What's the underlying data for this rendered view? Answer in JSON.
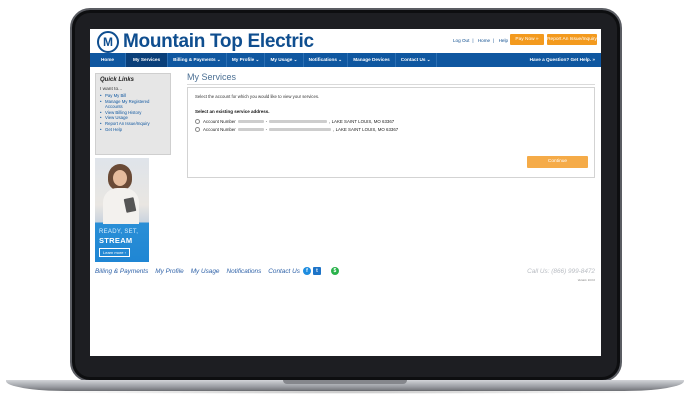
{
  "header": {
    "brand": "Mountain Top Electric",
    "logo_glyph": "M",
    "top_links": [
      "Log Out",
      "Home",
      "Help"
    ],
    "pay_now": "Pay Now »",
    "report_issue": "Report An Issue/Inquiry"
  },
  "nav": {
    "items": [
      {
        "label": "Home",
        "active": false
      },
      {
        "label": "My Services",
        "active": true
      },
      {
        "label": "Billing & Payments ⌄",
        "active": false
      },
      {
        "label": "My Profile ⌄",
        "active": false
      },
      {
        "label": "My Usage ⌄",
        "active": false
      },
      {
        "label": "Notifications ⌄",
        "active": false
      },
      {
        "label": "Manage Devices",
        "active": false
      },
      {
        "label": "Contact Us ⌄",
        "active": false
      }
    ],
    "help": "Have a Question? Get Help. »"
  },
  "quick_links": {
    "title": "Quick Links",
    "intro": "I want to...",
    "items": [
      "Pay My Bill",
      "Manage My Registered Accounts",
      "View Billing History",
      "View Usage",
      "Report An Issue/Inquiry",
      "Get Help"
    ]
  },
  "ad": {
    "line1": "READY, SET,",
    "line2": "STREAM",
    "button": "Learn more ›"
  },
  "main": {
    "title": "My Services",
    "prompt": "Select the account for which you would like to view your services.",
    "select_label": "Select an existing service address.",
    "accounts": [
      {
        "prefix": "Account Number",
        "suffix": ", LAKE SAINT LOUIS, MO 63367"
      },
      {
        "prefix": "Account Number",
        "suffix": ", LAKE SAINT LOUIS, MO 63367"
      }
    ],
    "continue": "Continue"
  },
  "footer": {
    "links": [
      "Billing & Payments",
      "My Profile",
      "My Usage",
      "Notifications",
      "Contact Us"
    ],
    "call": "Call Us: (866) 999-8472",
    "version": "Version: 10.0.0"
  },
  "colors": {
    "brand_blue": "#0f4e8f",
    "nav_blue": "#0f57a0",
    "accent_orange": "#f39a1e"
  }
}
